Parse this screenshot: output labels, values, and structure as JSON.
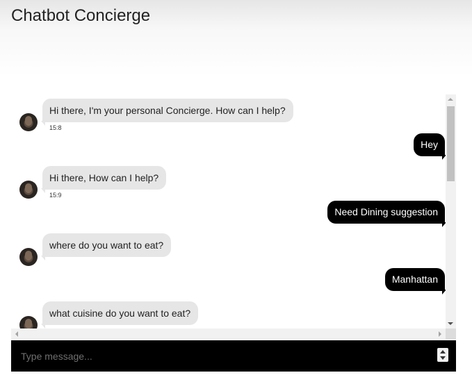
{
  "app": {
    "title": "Chatbot Concierge"
  },
  "messages": [
    {
      "sender": "bot",
      "text": "Hi there, I'm your personal Concierge. How can I help?",
      "time": "15:8"
    },
    {
      "sender": "user",
      "text": "Hey"
    },
    {
      "sender": "bot",
      "text": "Hi there, How can I help?",
      "time": "15:9"
    },
    {
      "sender": "user",
      "text": "Need Dining suggestion"
    },
    {
      "sender": "bot",
      "text": "where do you want to eat?"
    },
    {
      "sender": "user",
      "text": "Manhattan"
    },
    {
      "sender": "bot",
      "text": "what cuisine do you want to eat?"
    }
  ],
  "composer": {
    "placeholder": "Type message..."
  }
}
